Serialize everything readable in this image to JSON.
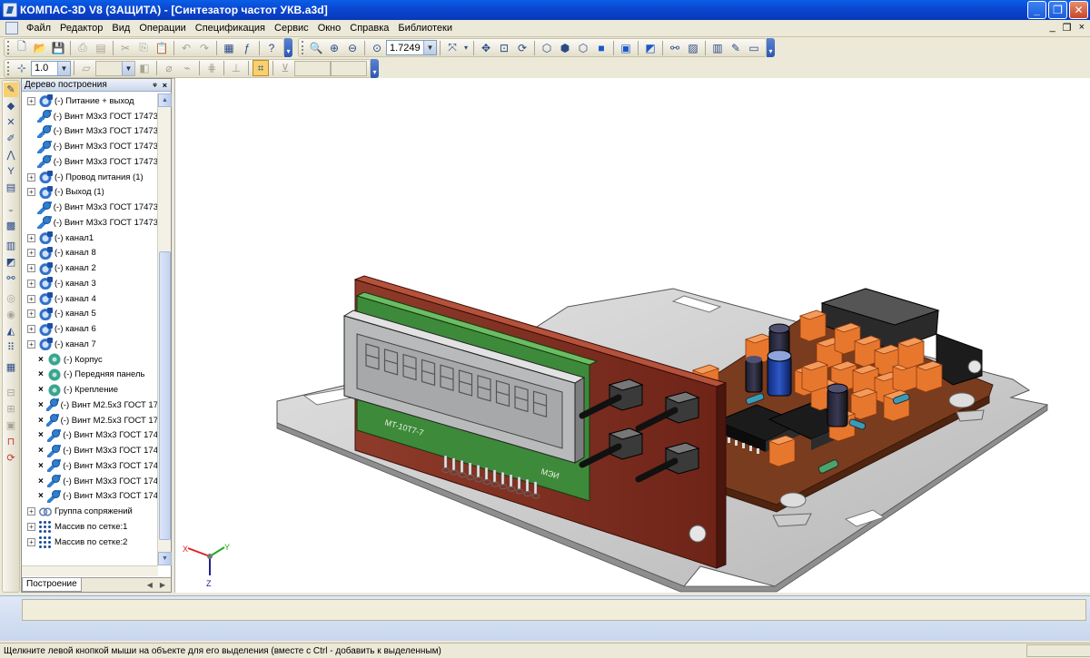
{
  "window": {
    "title": "КОМПАС-3D V8 (ЗАЩИТА) - [Синтезатор частот УКВ.a3d]",
    "minimize": "_",
    "restore": "❐",
    "close": "✕"
  },
  "menu": [
    "Файл",
    "Редактор",
    "Вид",
    "Операции",
    "Спецификация",
    "Сервис",
    "Окно",
    "Справка",
    "Библиотеки"
  ],
  "mdi_controls": [
    "_",
    "❐",
    "×"
  ],
  "toolbar": {
    "zoom_value": "1.7249",
    "step_value": "1.0"
  },
  "tree_panel": {
    "title": "Дерево построения",
    "pin": "ᵠ",
    "close": "×",
    "tab_label": "Построение",
    "items": [
      {
        "type": "asm",
        "expand": true,
        "mark": false,
        "label": "(-) Питание + выход"
      },
      {
        "type": "screw",
        "expand": false,
        "mark": false,
        "label": "(-) Винт М3х3 ГОСТ 17473"
      },
      {
        "type": "screw",
        "expand": false,
        "mark": false,
        "label": "(-) Винт М3х3 ГОСТ 17473"
      },
      {
        "type": "screw",
        "expand": false,
        "mark": false,
        "label": "(-) Винт М3х3 ГОСТ 17473"
      },
      {
        "type": "screw",
        "expand": false,
        "mark": false,
        "label": "(-) Винт М3х3 ГОСТ 17473"
      },
      {
        "type": "asm",
        "expand": true,
        "mark": false,
        "label": "(-) Провод питания (1)"
      },
      {
        "type": "asm",
        "expand": true,
        "mark": false,
        "label": "(-) Выход (1)"
      },
      {
        "type": "screw",
        "expand": false,
        "mark": false,
        "label": "(-) Винт М3х3 ГОСТ 17473"
      },
      {
        "type": "screw",
        "expand": false,
        "mark": false,
        "label": "(-) Винт М3х3 ГОСТ 17473"
      },
      {
        "type": "asm",
        "expand": true,
        "mark": false,
        "label": "(-) канал1"
      },
      {
        "type": "asm",
        "expand": true,
        "mark": false,
        "label": "(-) канал 8"
      },
      {
        "type": "asm",
        "expand": true,
        "mark": false,
        "label": "(-) канал 2"
      },
      {
        "type": "asm",
        "expand": true,
        "mark": false,
        "label": "(-) канал 3"
      },
      {
        "type": "asm",
        "expand": true,
        "mark": false,
        "label": "(-) канал 4"
      },
      {
        "type": "asm",
        "expand": true,
        "mark": false,
        "label": "(-) канал 5"
      },
      {
        "type": "asm",
        "expand": true,
        "mark": false,
        "label": "(-) канал 6"
      },
      {
        "type": "asm",
        "expand": true,
        "mark": false,
        "label": "(-) канал 7"
      },
      {
        "type": "part",
        "expand": false,
        "mark": true,
        "label": "(-) Корпус"
      },
      {
        "type": "part",
        "expand": false,
        "mark": true,
        "label": "(-) Передняя панель"
      },
      {
        "type": "part",
        "expand": false,
        "mark": true,
        "label": "(-) Крепление"
      },
      {
        "type": "screw",
        "expand": false,
        "mark": true,
        "label": "(-) Винт М2.5х3 ГОСТ 17"
      },
      {
        "type": "screw",
        "expand": false,
        "mark": true,
        "label": "(-) Винт М2.5х3 ГОСТ 17"
      },
      {
        "type": "screw",
        "expand": false,
        "mark": true,
        "label": "(-) Винт М3х3 ГОСТ 174"
      },
      {
        "type": "screw",
        "expand": false,
        "mark": true,
        "label": "(-) Винт М3х3 ГОСТ 174"
      },
      {
        "type": "screw",
        "expand": false,
        "mark": true,
        "label": "(-) Винт М3х3 ГОСТ 174"
      },
      {
        "type": "screw",
        "expand": false,
        "mark": true,
        "label": "(-) Винт М3х3 ГОСТ 174"
      },
      {
        "type": "screw",
        "expand": false,
        "mark": true,
        "label": "(-) Винт М3х3 ГОСТ 174"
      },
      {
        "type": "mate",
        "expand": true,
        "mark": false,
        "label": "Группа сопряжений"
      },
      {
        "type": "array",
        "expand": true,
        "mark": false,
        "label": "Массив по сетке:1"
      },
      {
        "type": "array",
        "expand": true,
        "mark": false,
        "label": "Массив по сетке:2"
      }
    ]
  },
  "viewport": {
    "axes": {
      "x": "X",
      "y": "Y",
      "z": "Z"
    },
    "model_labels": {
      "display_part": "MT-10T7-7",
      "panel_brand": "МЭИ"
    },
    "colors": {
      "panel": "#8b2f20",
      "pcb": "#3d8a3a",
      "board": "#7a3c1e",
      "chassis": "#c6c6c6",
      "capacitor": "#e8772e",
      "lcd": "#bfc0c0"
    }
  },
  "status": {
    "message": "Щелкните левой кнопкой мыши на объекте для его выделения (вместе с Ctrl - добавить к выделенным)"
  }
}
